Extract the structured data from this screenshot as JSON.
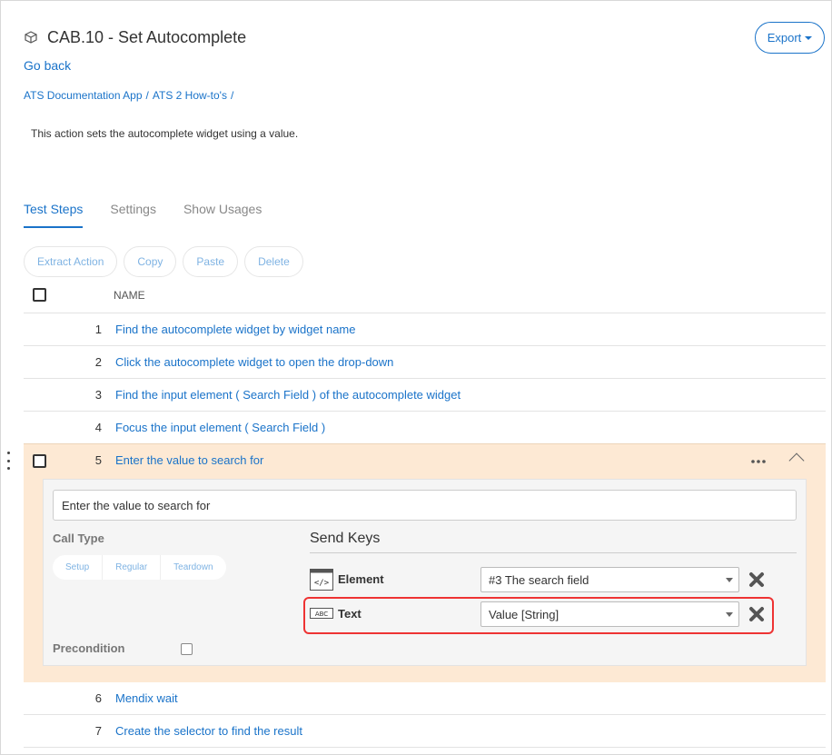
{
  "page": {
    "title": "CAB.10 - Set Autocomplete",
    "go_back": "Go back",
    "breadcrumbs": [
      "ATS Documentation App",
      "ATS 2 How-to's"
    ],
    "breadcrumb_sep": "/",
    "description": "This action sets the autocomplete widget using a value.",
    "export_label": "Export"
  },
  "tabs": [
    {
      "label": "Test Steps",
      "active": true
    },
    {
      "label": "Settings",
      "active": false
    },
    {
      "label": "Show Usages",
      "active": false
    }
  ],
  "toolbar": {
    "extract": "Extract Action",
    "copy": "Copy",
    "paste": "Paste",
    "delete": "Delete"
  },
  "table": {
    "column_name": "NAME",
    "rows": [
      {
        "num": "1",
        "name": "Find the autocomplete widget by widget name"
      },
      {
        "num": "2",
        "name": "Click the autocomplete widget to open the drop-down"
      },
      {
        "num": "3",
        "name": "Find the input element ( Search Field ) of the autocomplete widget"
      },
      {
        "num": "4",
        "name": "Focus the input element ( Search Field )"
      },
      {
        "num": "5",
        "name": "Enter the value to search for"
      },
      {
        "num": "6",
        "name": "Mendix wait"
      },
      {
        "num": "7",
        "name": "Create the selector to find the result"
      }
    ]
  },
  "step_detail": {
    "description_value": "Enter the value to search for",
    "call_type_label": "Call Type",
    "call_types": [
      "Setup",
      "Regular",
      "Teardown"
    ],
    "precondition_label": "Precondition",
    "action_title": "Send Keys",
    "params": [
      {
        "label": "Element",
        "icon": "code-element-icon",
        "icon_text": "</>",
        "value": "#3 The search field"
      },
      {
        "label": "Text",
        "icon": "abc-text-icon",
        "icon_text": "ABC",
        "value": "Value [String]"
      }
    ]
  },
  "colors": {
    "accent": "#1a73c9",
    "expanded_bg": "#fde9d4",
    "highlight": "#e33333"
  }
}
